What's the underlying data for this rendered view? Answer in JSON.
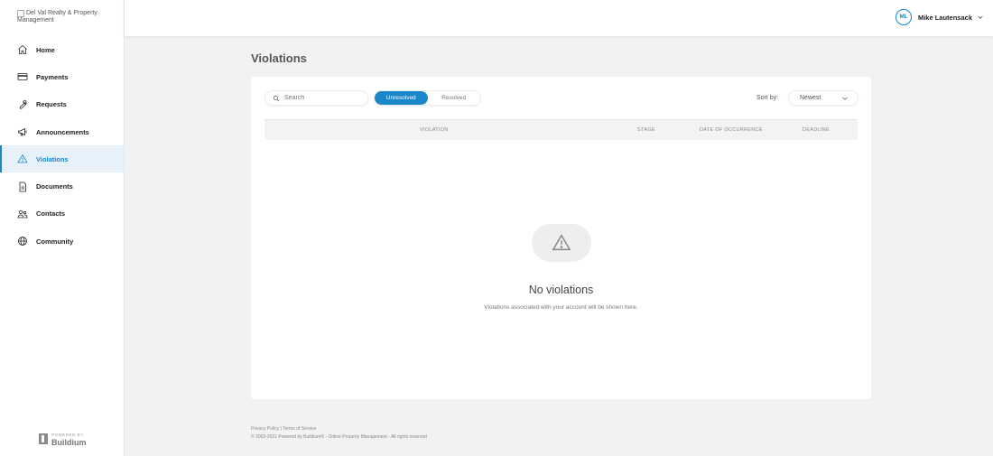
{
  "sidebar": {
    "logo_alt": "Del Val Realty & Property Management",
    "items": [
      {
        "label": "Home",
        "icon": "home-icon"
      },
      {
        "label": "Payments",
        "icon": "card-icon"
      },
      {
        "label": "Requests",
        "icon": "wrench-icon"
      },
      {
        "label": "Announcements",
        "icon": "megaphone-icon"
      },
      {
        "label": "Violations",
        "icon": "warning-icon",
        "active": true
      },
      {
        "label": "Documents",
        "icon": "document-icon"
      },
      {
        "label": "Contacts",
        "icon": "contacts-icon"
      },
      {
        "label": "Community",
        "icon": "globe-icon"
      }
    ],
    "powered_small": "POWERED BY",
    "powered_brand": "Buildium"
  },
  "header": {
    "avatar_initials": "ML",
    "user_name": "Mike Lautensack"
  },
  "main": {
    "title": "Violations",
    "search_placeholder": "Search",
    "tabs": [
      "Unresolved",
      "Resolved"
    ],
    "sort_label": "Sort by:",
    "sort_value": "Newest",
    "columns": [
      "VIOLATION",
      "STAGE",
      "DATE OF OCCURRENCE",
      "DEADLINE"
    ],
    "empty_title": "No violations",
    "empty_message": "Violations associated with your account will be shown here."
  },
  "footer": {
    "links": "Privacy Policy | Terms of Service",
    "copyright": "© 2003-2021 Powered by Buildium® - Online Property Management - All rights reserved"
  },
  "colors": {
    "accent": "#1a87c9",
    "background": "#f2f2f2"
  }
}
